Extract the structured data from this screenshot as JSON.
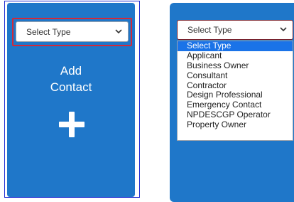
{
  "left_panel": {
    "select": {
      "selected": "Select Type"
    },
    "add_contact": {
      "line1": "Add",
      "line2": "Contact"
    }
  },
  "right_panel": {
    "select": {
      "selected": "Select Type"
    },
    "options": [
      "Select Type",
      "Applicant",
      "Business Owner",
      "Consultant",
      "Contractor",
      "Design Professional",
      "Emergency Contact",
      "NPDESCGP Operator",
      "Property Owner"
    ],
    "highlighted_index": 0
  },
  "colors": {
    "card_blue": "#1f77c9",
    "highlight_red": "#d12a3a",
    "option_highlight": "#1a73e8",
    "frame_blue": "#1f2bd1"
  }
}
